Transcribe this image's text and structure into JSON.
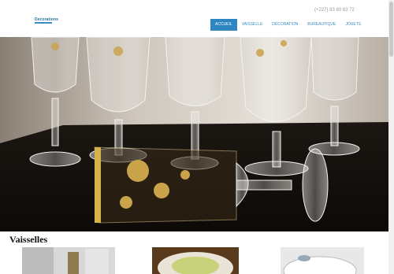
{
  "header": {
    "logo_text": "Decorations",
    "logo_sub": "",
    "phone": "(+227) 93 80 83 72"
  },
  "nav": {
    "items": [
      {
        "label": "ACCUEIL",
        "active": true
      },
      {
        "label": "VAISSELLE",
        "active": false
      },
      {
        "label": "DÉCORATION",
        "active": false
      },
      {
        "label": "BUREAUTIQUE",
        "active": false
      },
      {
        "label": "JOUETS",
        "active": false
      }
    ]
  },
  "hero": {
    "image": "crystal-glasses-photo"
  },
  "section": {
    "title": "Vaisselles"
  },
  "colors": {
    "accent": "#2e86c1",
    "nav_text": "#3d8cc0",
    "gold": "#c9a24a"
  }
}
